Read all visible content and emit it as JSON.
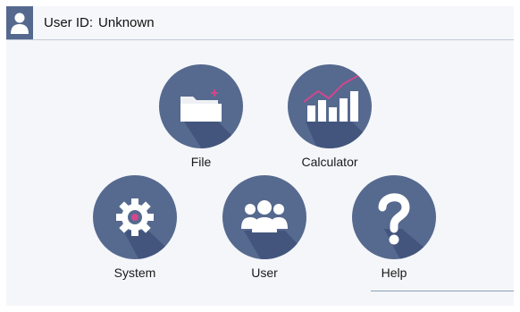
{
  "header": {
    "user_id_label": "User ID:",
    "user_id_value": "Unknown"
  },
  "tiles": [
    {
      "label": "File",
      "icon": "folder-icon"
    },
    {
      "label": "Calculator",
      "icon": "chart-icon"
    },
    {
      "label": "System",
      "icon": "gear-icon"
    },
    {
      "label": "User",
      "icon": "users-icon"
    },
    {
      "label": "Help",
      "icon": "question-icon"
    }
  ],
  "colors": {
    "circle": "#56698f",
    "shadow": "#3f5078",
    "icon": "#ffffff",
    "accent": "#d0488e"
  }
}
